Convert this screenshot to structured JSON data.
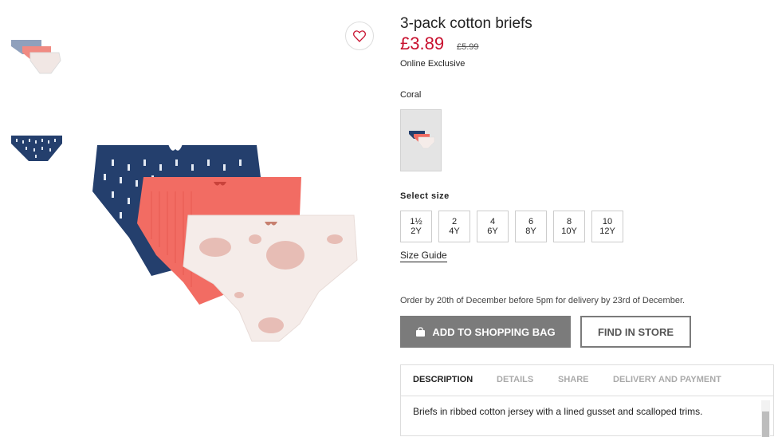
{
  "product": {
    "title": "3-pack cotton briefs",
    "price": "£3.89",
    "old_price": "£5.99",
    "badge": "Online Exclusive",
    "color_name": "Coral"
  },
  "sizes": {
    "label": "Select size",
    "options": [
      {
        "top": "1½",
        "bottom": "2Y"
      },
      {
        "top": "2",
        "bottom": "4Y"
      },
      {
        "top": "4",
        "bottom": "6Y"
      },
      {
        "top": "6",
        "bottom": "8Y"
      },
      {
        "top": "8",
        "bottom": "10Y"
      },
      {
        "top": "10",
        "bottom": "12Y"
      }
    ],
    "guide": "Size Guide"
  },
  "delivery_note": "Order by 20th of December before 5pm for delivery by 23rd of December.",
  "actions": {
    "add_to_bag": "ADD TO SHOPPING BAG",
    "find_in_store": "FIND IN STORE"
  },
  "tabs": [
    "DESCRIPTION",
    "DETAILS",
    "SHARE",
    "DELIVERY AND PAYMENT"
  ],
  "description": "Briefs in ribbed cotton jersey with a lined gusset and scalloped trims.",
  "colors": {
    "price": "#c8102e",
    "navy": "#243f6d",
    "coral": "#f26c63",
    "cream": "#f4ebe8",
    "button_gray": "#7b7b7b"
  },
  "icons": [
    "heart-icon",
    "shopping-bag-icon"
  ]
}
